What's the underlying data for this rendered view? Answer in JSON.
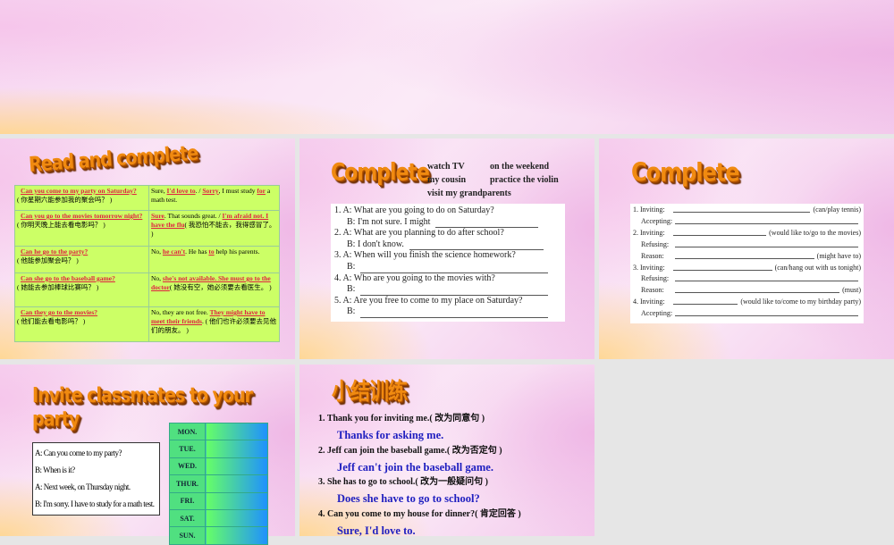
{
  "slide1": {
    "title": "Read and complete",
    "rows": [
      {
        "q": "Can you come to my party on Saturday?",
        "cn": "( 你星期六能参加我的聚会吗？ )",
        "a": [
          "Sure, ",
          "I'd love to",
          ". / ",
          "Sorry",
          ", I must study ",
          "for",
          " a math test."
        ]
      },
      {
        "q": "Can you go to the movies tomorrow night?",
        "cn": "( 你明天晚上能去看电影吗？ )",
        "a": [
          "",
          "Sure",
          ". That sounds great. / ",
          "I'm afraid not. I have the flu",
          "( 我恐怕不能去，我得感冒了。 )",
          "",
          ""
        ]
      },
      {
        "q": "Can he go to the party?",
        "cn": "( 他能参加聚会吗？ )",
        "a": [
          "No, ",
          "he can't",
          ". He has ",
          "to",
          " help his parents.",
          "",
          ""
        ]
      },
      {
        "q": "Can she go to the baseball game?",
        "cn": "( 她能去参加棒球比赛吗？ )",
        "a": [
          "No, ",
          "she's not available. She must go to the doctor",
          "( 她没有空，她必须要去看医生。 )",
          "",
          "",
          "",
          ""
        ]
      },
      {
        "q": "Can they go to the movies?",
        "cn": "( 他们能去看电影吗？ )",
        "a": [
          "No, they are not free. ",
          "They might have to meet their friends",
          ". ( 他们也许必须要去见他们的朋友。 )",
          "",
          "",
          "",
          ""
        ]
      }
    ]
  },
  "slide2": {
    "title": "Complete",
    "words": [
      "watch TV",
      "on the weekend",
      "my cousin",
      "practice the violin",
      "visit my grandparents"
    ],
    "lines": [
      "1. A: What are you going to do on Saturday?",
      "B: I'm not sure. I might",
      "2. A: What are you planning to do after school?",
      "B: I don't know.",
      "3. A: When will you finish the science homework?",
      "B:",
      "4. A: Who are you going to the movies with?",
      "B:",
      "5. A: Are you free to come to my place on Saturday?",
      "B:"
    ]
  },
  "slide3": {
    "title": "Complete",
    "lines": [
      {
        "l": "1. Inviting:",
        "h": "(can/play tennis)"
      },
      {
        "l": "Accepting:",
        "h": ""
      },
      {
        "l": "2. Inviting:",
        "h": "(would like to/go to the movies)"
      },
      {
        "l": "Refusing:",
        "h": ""
      },
      {
        "l": "Reason:",
        "h": "(might have to)"
      },
      {
        "l": "3. Inviting:",
        "h": "(can/hang out with us tonight)"
      },
      {
        "l": "Refusing:",
        "h": ""
      },
      {
        "l": "Reason:",
        "h": "(must)"
      },
      {
        "l": "4. Inviting:",
        "h": "(would like to/come to my birthday party)"
      },
      {
        "l": "Accepting:",
        "h": ""
      }
    ]
  },
  "slide4": {
    "title": "Invite classmates to your party",
    "dialog": [
      "A: Can you come to my party?",
      "B: When is it?",
      "A: Next week, on Thursday night.",
      "B: I'm sorry. I have to study for a math test."
    ],
    "days": [
      "MON.",
      "TUE.",
      "WED.",
      "THUR.",
      "FRI.",
      "SAT.",
      "SUN."
    ]
  },
  "slide5": {
    "title": "小结训练",
    "items": [
      {
        "q": "1. Thank you for inviting me.( 改为同意句 )",
        "a": "Thanks for asking me."
      },
      {
        "q": "2. Jeff can join the baseball game.( 改为否定句 )",
        "a": "Jeff can't join the baseball game."
      },
      {
        "q": "3. She has to go to school.( 改为一般疑问句 )",
        "a": "Does she have to go to school?"
      },
      {
        "q": "4. Can you come to my house for dinner?( 肯定回答 )",
        "a": "Sure, I'd love to."
      }
    ]
  }
}
